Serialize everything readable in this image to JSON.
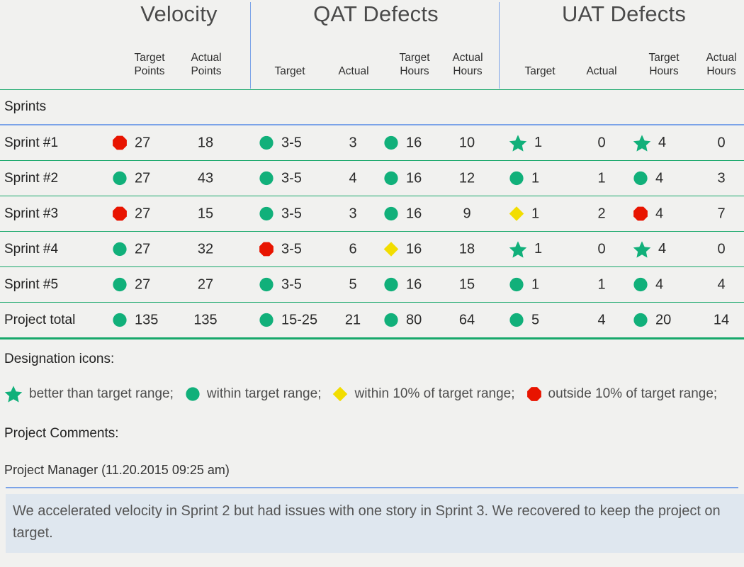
{
  "colors": {
    "green": "#11b07a",
    "red": "#e81400",
    "yellow": "#f2dd00",
    "rule_green": "#18a86b",
    "rule_blue": "#7ba3e8",
    "background": "#f1f1ef",
    "comment_background": "#dfe7ef"
  },
  "groups": [
    {
      "title": "Velocity"
    },
    {
      "title": "QAT Defects"
    },
    {
      "title": "UAT Defects"
    }
  ],
  "columns": [
    {
      "line1": "Target",
      "line2": "Points"
    },
    {
      "line1": "Actual",
      "line2": "Points"
    },
    {
      "line1": "Target",
      "line2": ""
    },
    {
      "line1": "Actual",
      "line2": ""
    },
    {
      "line1": "Target",
      "line2": "Hours"
    },
    {
      "line1": "Actual",
      "line2": "Hours"
    },
    {
      "line1": "Target",
      "line2": ""
    },
    {
      "line1": "Actual",
      "line2": ""
    },
    {
      "line1": "Target",
      "line2": "Hours"
    },
    {
      "line1": "Actual",
      "line2": "Hours"
    }
  ],
  "section_label": "Sprints",
  "rows": [
    {
      "label": "Sprint #1",
      "cells": [
        {
          "icon": "octagon",
          "value": "27"
        },
        {
          "icon": null,
          "value": "18"
        },
        {
          "icon": "circle",
          "value": "3-5"
        },
        {
          "icon": null,
          "value": "3"
        },
        {
          "icon": "circle",
          "value": "16"
        },
        {
          "icon": null,
          "value": "10"
        },
        {
          "icon": "star",
          "value": "1"
        },
        {
          "icon": null,
          "value": "0"
        },
        {
          "icon": "star",
          "value": "4"
        },
        {
          "icon": null,
          "value": "0"
        }
      ]
    },
    {
      "label": "Sprint #2",
      "cells": [
        {
          "icon": "circle",
          "value": "27"
        },
        {
          "icon": null,
          "value": "43"
        },
        {
          "icon": "circle",
          "value": "3-5"
        },
        {
          "icon": null,
          "value": "4"
        },
        {
          "icon": "circle",
          "value": "16"
        },
        {
          "icon": null,
          "value": "12"
        },
        {
          "icon": "circle",
          "value": "1"
        },
        {
          "icon": null,
          "value": "1"
        },
        {
          "icon": "circle",
          "value": "4"
        },
        {
          "icon": null,
          "value": "3"
        }
      ]
    },
    {
      "label": "Sprint #3",
      "cells": [
        {
          "icon": "octagon",
          "value": "27"
        },
        {
          "icon": null,
          "value": "15"
        },
        {
          "icon": "circle",
          "value": "3-5"
        },
        {
          "icon": null,
          "value": "3"
        },
        {
          "icon": "circle",
          "value": "16"
        },
        {
          "icon": null,
          "value": "9"
        },
        {
          "icon": "diamond",
          "value": "1"
        },
        {
          "icon": null,
          "value": "2"
        },
        {
          "icon": "octagon",
          "value": "4"
        },
        {
          "icon": null,
          "value": "7"
        }
      ]
    },
    {
      "label": "Sprint #4",
      "cells": [
        {
          "icon": "circle",
          "value": "27"
        },
        {
          "icon": null,
          "value": "32"
        },
        {
          "icon": "octagon",
          "value": "3-5"
        },
        {
          "icon": null,
          "value": "6"
        },
        {
          "icon": "diamond",
          "value": "16"
        },
        {
          "icon": null,
          "value": "18"
        },
        {
          "icon": "star",
          "value": "1"
        },
        {
          "icon": null,
          "value": "0"
        },
        {
          "icon": "star",
          "value": "4"
        },
        {
          "icon": null,
          "value": "0"
        }
      ]
    },
    {
      "label": "Sprint #5",
      "cells": [
        {
          "icon": "circle",
          "value": "27"
        },
        {
          "icon": null,
          "value": "27"
        },
        {
          "icon": "circle",
          "value": "3-5"
        },
        {
          "icon": null,
          "value": "5"
        },
        {
          "icon": "circle",
          "value": "16"
        },
        {
          "icon": null,
          "value": "15"
        },
        {
          "icon": "circle",
          "value": "1"
        },
        {
          "icon": null,
          "value": "1"
        },
        {
          "icon": "circle",
          "value": "4"
        },
        {
          "icon": null,
          "value": "4"
        }
      ]
    },
    {
      "label": "Project total",
      "cells": [
        {
          "icon": "circle",
          "value": "135"
        },
        {
          "icon": null,
          "value": "135"
        },
        {
          "icon": "circle",
          "value": "15-25"
        },
        {
          "icon": null,
          "value": "21"
        },
        {
          "icon": "circle",
          "value": "80"
        },
        {
          "icon": null,
          "value": "64"
        },
        {
          "icon": "circle",
          "value": "5"
        },
        {
          "icon": null,
          "value": "4"
        },
        {
          "icon": "circle",
          "value": "20"
        },
        {
          "icon": null,
          "value": "14"
        }
      ]
    }
  ],
  "legend": {
    "title": "Designation icons:",
    "items": [
      {
        "icon": "star",
        "text": "better than target range;"
      },
      {
        "icon": "circle",
        "text": "within target range;"
      },
      {
        "icon": "diamond",
        "text": "within 10% of target range;"
      },
      {
        "icon": "octagon",
        "text": "outside 10% of target range;"
      }
    ]
  },
  "comments": {
    "title": "Project Comments:",
    "author": "Project Manager (11.20.2015 09:25 am)",
    "body": "We accelerated velocity in Sprint 2 but had issues with one story in Sprint 3. We recovered to keep the project on target."
  }
}
